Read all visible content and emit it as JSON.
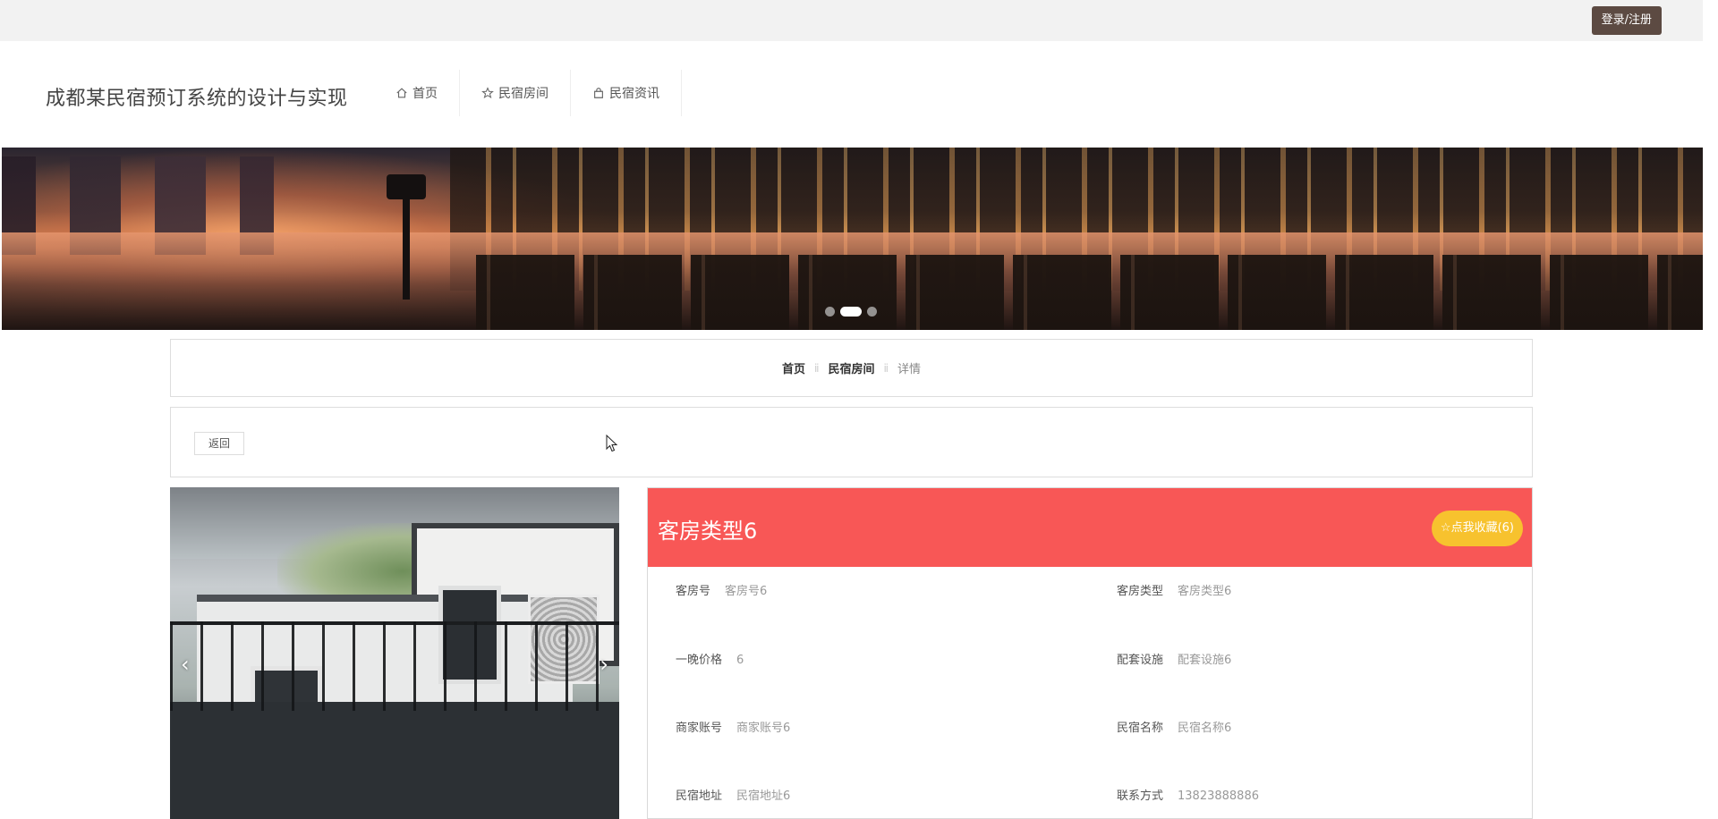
{
  "topbar": {
    "login_label": "登录/注册"
  },
  "header": {
    "site_title": "成都某民宿预订系统的设计与实现",
    "nav": [
      {
        "label": "首页",
        "icon": "home-icon"
      },
      {
        "label": "民宿房间",
        "icon": "star-icon"
      },
      {
        "label": "民宿资讯",
        "icon": "bag-icon"
      }
    ]
  },
  "banner": {
    "active_slide": 2,
    "slide_count": 3
  },
  "breadcrumb": {
    "items": [
      "首页",
      "民宿房间",
      "详情"
    ],
    "separator": "ⅱ"
  },
  "actions": {
    "back_label": "返回"
  },
  "gallery": {
    "prev": "‹",
    "next": "›"
  },
  "detail": {
    "title": "客房类型6",
    "favorite_label": "☆点我收藏(6)",
    "fields": {
      "room_no": {
        "label": "客房号",
        "value": "客房号6"
      },
      "room_type": {
        "label": "客房类型",
        "value": "客房类型6"
      },
      "price": {
        "label": "一晚价格",
        "value": "6"
      },
      "facilities": {
        "label": "配套设施",
        "value": "配套设施6"
      },
      "merchant_account": {
        "label": "商家账号",
        "value": "商家账号6"
      },
      "bnb_name": {
        "label": "民宿名称",
        "value": "民宿名称6"
      },
      "bnb_address": {
        "label": "民宿地址",
        "value": "民宿地址6"
      },
      "contact": {
        "label": "联系方式",
        "value": "13823888886"
      }
    }
  },
  "colors": {
    "detail_header": "#f85756",
    "favorite_button": "#f7c22e",
    "login_button": "#5c4a42"
  }
}
